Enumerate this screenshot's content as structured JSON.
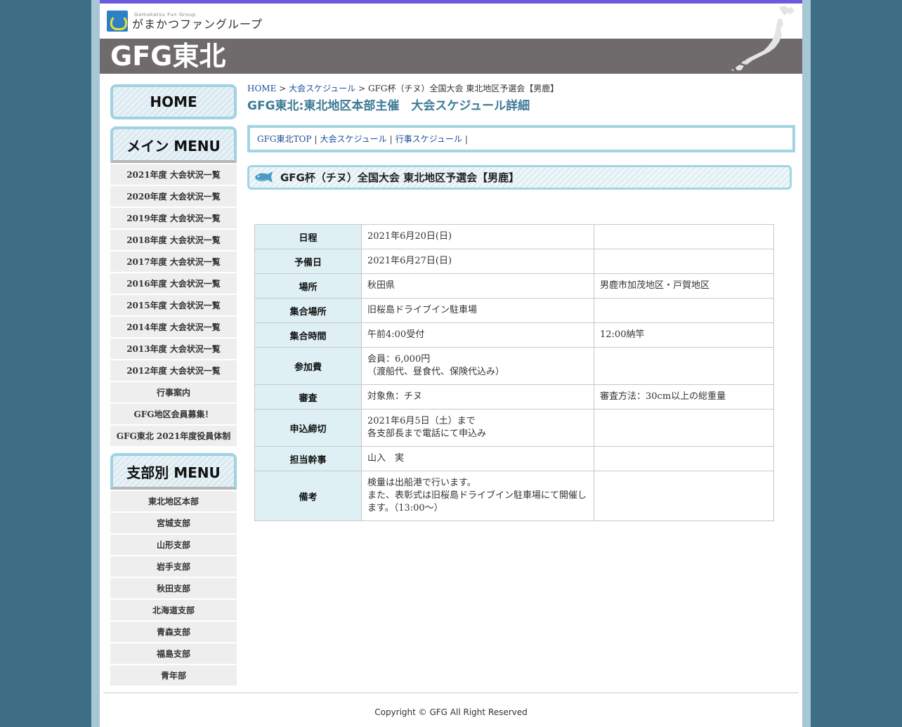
{
  "header": {
    "logo_sub": "Gamakatsu Fun Group",
    "logo_main": "がまかつファングループ",
    "site_title": "GFG東北"
  },
  "sidebar": {
    "home_label": "HOME",
    "main_menu_title": "メイン MENU",
    "main_items": [
      "2021年度 大会状況一覧",
      "2020年度 大会状況一覧",
      "2019年度 大会状況一覧",
      "2018年度 大会状況一覧",
      "2017年度 大会状況一覧",
      "2016年度 大会状況一覧",
      "2015年度 大会状況一覧",
      "2014年度 大会状況一覧",
      "2013年度 大会状況一覧",
      "2012年度 大会状況一覧",
      "行事案内",
      "GFG地区会員募集！",
      "GFG東北 2021年度役員体制"
    ],
    "branch_menu_title": "支部別 MENU",
    "branch_items": [
      "東北地区本部",
      "宮城支部",
      "山形支部",
      "岩手支部",
      "秋田支部",
      "北海道支部",
      "青森支部",
      "福島支部",
      "青年部"
    ]
  },
  "breadcrumb": {
    "home": "HOME",
    "sep": ">",
    "schedule": "大会スケジュール",
    "current": "GFG杯（チヌ）全国大会 東北地区予選会【男鹿】"
  },
  "page_heading": "GFG東北:東北地区本部主催　大会スケジュール詳細",
  "subnav": {
    "items": [
      "GFG東北TOP",
      "大会スケジュール",
      "行事スケジュール"
    ],
    "sep": "|"
  },
  "event_title": "GFG杯（チヌ）全国大会 東北地区予選会【男鹿】",
  "details": [
    {
      "label": "日程",
      "main": "2021年6月20日(日)",
      "note": ""
    },
    {
      "label": "予備日",
      "main": "2021年6月27日(日)",
      "note": ""
    },
    {
      "label": "場所",
      "main": "秋田県",
      "note": "男鹿市加茂地区・戸賀地区"
    },
    {
      "label": "集合場所",
      "main": "旧桜島ドライブイン駐車場",
      "note": ""
    },
    {
      "label": "集合時間",
      "main": "午前4:00受付",
      "note": "12:00納竿"
    },
    {
      "label": "参加費",
      "main": "会員：6,000円\n（渡船代、昼食代、保険代込み）",
      "note": ""
    },
    {
      "label": "審査",
      "main": "対象魚：チヌ",
      "note": "審査方法：30cm以上の総重量"
    },
    {
      "label": "申込締切",
      "main": "2021年6月5日（土）まで\n各支部長まで電話にて申込み",
      "note": ""
    },
    {
      "label": "担当幹事",
      "main": "山入　実",
      "note": ""
    },
    {
      "label": "備考",
      "main": "検量は出船港で行います。\nまた、表彰式は旧桜島ドライブイン駐車場にて開催します。（13:00～）",
      "note": ""
    }
  ],
  "footer": "Copyright © GFG All Right Reserved"
}
